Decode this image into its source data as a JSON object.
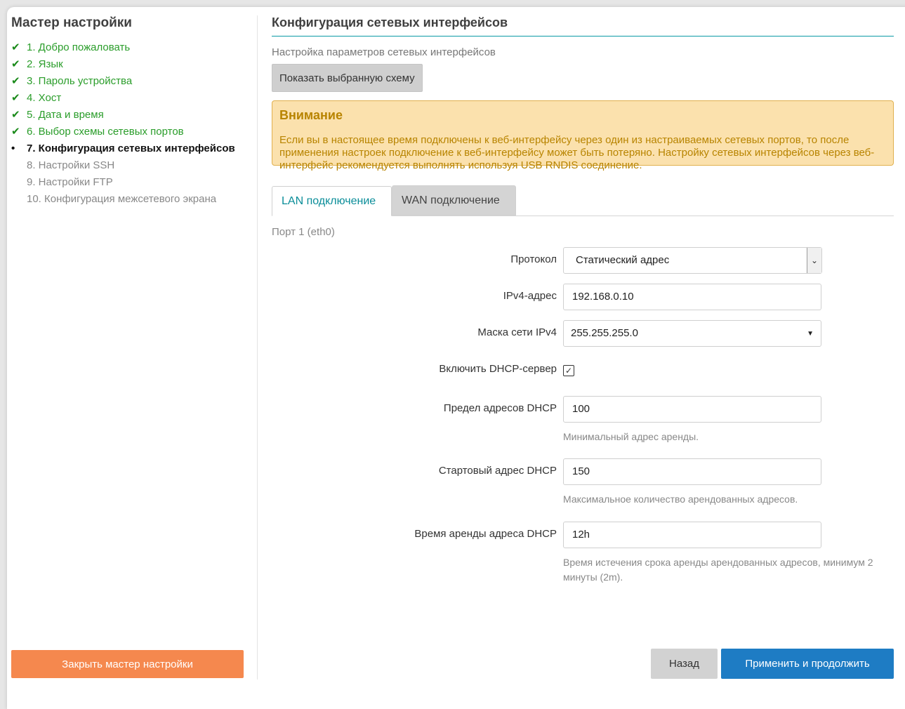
{
  "sidebar": {
    "title": "Мастер настройки",
    "steps": [
      {
        "mark": "✔",
        "label": "1. Добро пожаловать",
        "state": "done"
      },
      {
        "mark": "✔",
        "label": "2. Язык",
        "state": "done"
      },
      {
        "mark": "✔",
        "label": "3. Пароль устройства",
        "state": "done"
      },
      {
        "mark": "✔",
        "label": "4. Хост",
        "state": "done"
      },
      {
        "mark": "✔",
        "label": "5. Дата и время",
        "state": "done"
      },
      {
        "mark": "✔",
        "label": "6. Выбор схемы сетевых портов",
        "state": "done"
      },
      {
        "mark": "•",
        "label": "7. Конфигурация сетевых интерфейсов",
        "state": "active"
      },
      {
        "mark": "",
        "label": "8. Настройки SSH",
        "state": "pending"
      },
      {
        "mark": "",
        "label": "9. Настройки FTP",
        "state": "pending"
      },
      {
        "mark": "",
        "label": "10. Конфигурация межсетевого экрана",
        "state": "pending"
      }
    ],
    "close_label": "Закрыть мастер настройки"
  },
  "main": {
    "title": "Конфигурация сетевых интерфейсов",
    "description": "Настройка параметров сетевых интерфейсов",
    "show_schema_label": "Показать выбранную схему",
    "alert": {
      "title": "Внимание",
      "text": "Если вы в настоящее время подключены к веб-интерфейсу через один из настраиваемых сетевых портов, то после применения настроек подключение к веб-интерфейсу может быть потеряно. Настройку сетевых интерфейсов через веб-интерфейс рекомендуется выполнять используя USB RNDIS соединение."
    },
    "tabs": [
      {
        "label": "LAN подключение",
        "active": true
      },
      {
        "label": "WAN подключение",
        "active": false
      }
    ],
    "section_title": "Порт 1 (eth0)",
    "form": {
      "protocol": {
        "label": "Протокол",
        "value": "Статический адрес"
      },
      "ipv4": {
        "label": "IPv4-адрес",
        "value": "192.168.0.10"
      },
      "netmask": {
        "label": "Маска сети IPv4",
        "value": "255.255.255.0"
      },
      "dhcp_enable": {
        "label": "Включить DHCP-сервер",
        "checked": true,
        "mark": "✓"
      },
      "dhcp_limit": {
        "label": "Предел адресов DHCP",
        "value": "100",
        "hint": "Минимальный адрес аренды."
      },
      "dhcp_start": {
        "label": "Стартовый адрес DHCP",
        "value": "150",
        "hint": "Максимальное количество арендованных адресов."
      },
      "dhcp_lease": {
        "label": "Время аренды адреса DHCP",
        "value": "12h",
        "hint": "Время истечения срока аренды арендованных адресов, минимум 2 минуты (2m)."
      }
    },
    "back_label": "Назад",
    "apply_label": "Применить и продолжить"
  },
  "colors": {
    "accent": "#0a8d99",
    "done": "#2a9d2a",
    "close_button": "#f5884e",
    "apply_button": "#1e7cc4",
    "alert_bg": "#fbe1ad",
    "alert_text": "#b88400"
  }
}
